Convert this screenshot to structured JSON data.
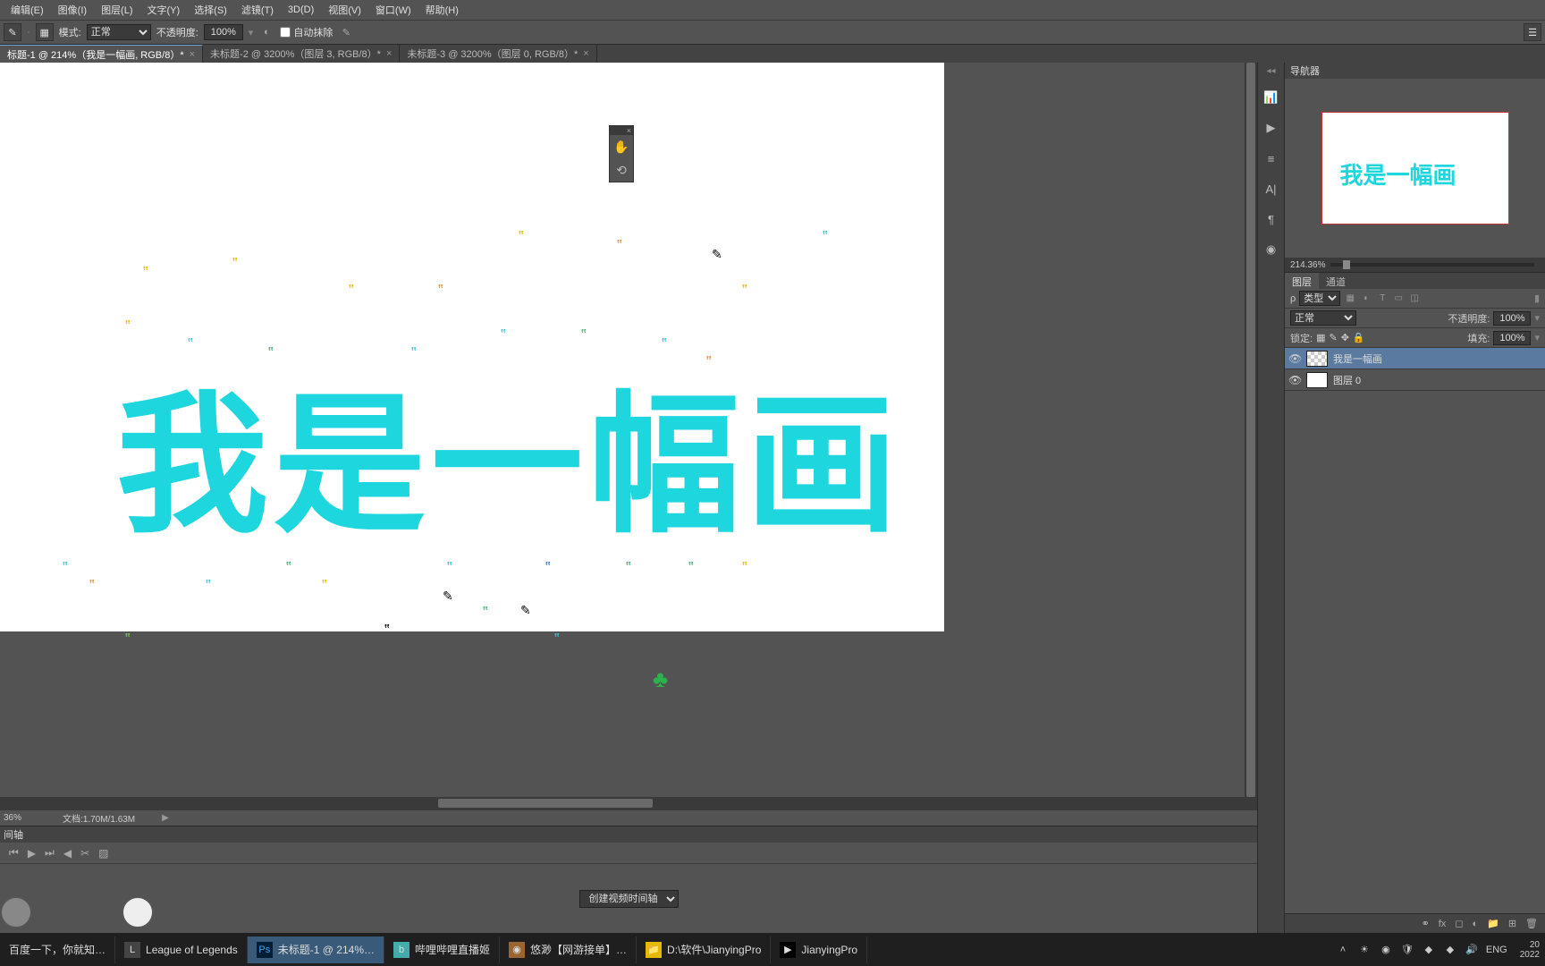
{
  "menu": {
    "items": [
      "编辑(E)",
      "图像(I)",
      "图层(L)",
      "文字(Y)",
      "选择(S)",
      "滤镜(T)",
      "3D(D)",
      "视图(V)",
      "窗口(W)",
      "帮助(H)"
    ]
  },
  "options": {
    "mode_label": "模式:",
    "mode_value": "正常",
    "opacity_label": "不透明度:",
    "opacity_value": "100%",
    "auto_erase": "自动抹除"
  },
  "tabs": [
    {
      "label": "标题-1 @ 214%（我是一幅画, RGB/8）*",
      "active": true
    },
    {
      "label": "未标题-2 @ 3200%（图层 3, RGB/8）*",
      "active": false
    },
    {
      "label": "未标题-3 @ 3200%（图层 0, RGB/8）*",
      "active": false
    }
  ],
  "canvas": {
    "text": "我是一幅画"
  },
  "status": {
    "zoom": "36%",
    "doc": "文档:1.70M/1.63M"
  },
  "timeline": {
    "tab": "间轴",
    "create": "创建视频时间轴"
  },
  "navigator": {
    "tab": "导航器",
    "zoom": "214.36%",
    "thumb_text": "我是一幅画"
  },
  "layers_panel": {
    "tabs": [
      "图层",
      "通道"
    ],
    "kind_label": "类型",
    "blend_value": "正常",
    "opacity_label": "不透明度:",
    "opacity_value": "100%",
    "lock_label": "锁定:",
    "fill_label": "填充:",
    "fill_value": "100%",
    "layers": [
      {
        "name": "我是一幅画",
        "selected": true
      },
      {
        "name": "图层 0",
        "selected": false
      }
    ]
  },
  "taskbar": {
    "items": [
      {
        "label": "百度一下，你就知…"
      },
      {
        "label": "League of Legends"
      },
      {
        "label": "未标题-1 @ 214%…",
        "active": true
      },
      {
        "label": "哔哩哔哩直播姬"
      },
      {
        "label": "悠渺【网游接单】…"
      },
      {
        "label": "D:\\软件\\JianyingPro"
      },
      {
        "label": "JianyingPro"
      }
    ],
    "ime": "ENG",
    "time": "20",
    "date": "2022"
  }
}
